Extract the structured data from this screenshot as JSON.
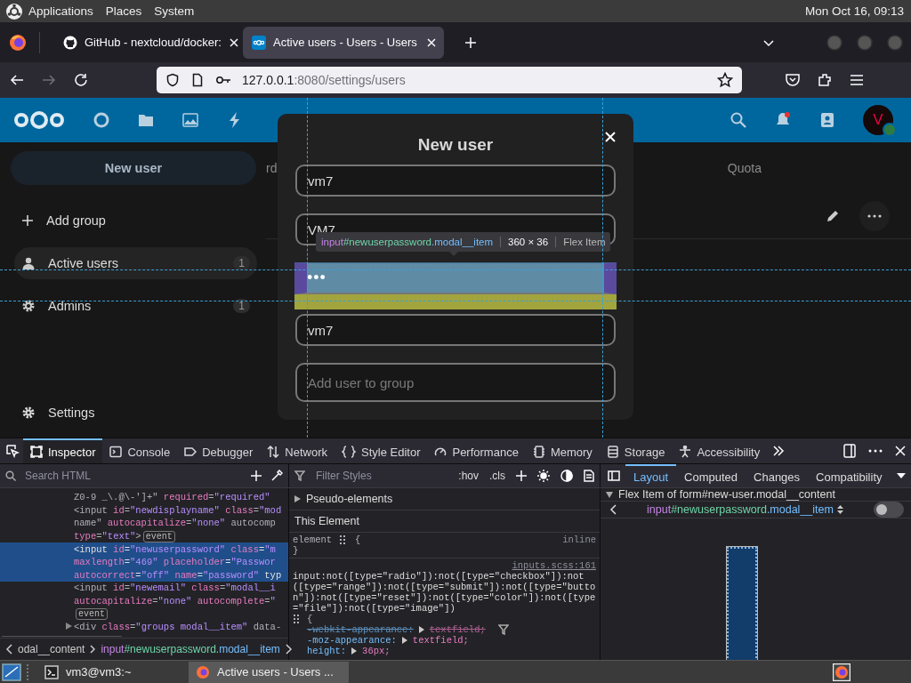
{
  "desktop_panel": {
    "menus": [
      "Applications",
      "Places",
      "System"
    ],
    "clock": "Mon Oct 16, 09:13"
  },
  "browser": {
    "tabs": [
      {
        "title": "GitHub - nextcloud/docker:",
        "kind": "github",
        "selected": false
      },
      {
        "title": "Active users - Users - Users",
        "kind": "nextcloud",
        "selected": true
      }
    ],
    "address": {
      "host": "127.0.0.1",
      "path": ":8080/settings/users"
    }
  },
  "nextcloud": {
    "avatar_letter": "V",
    "sidebar": {
      "new_user": "New user",
      "add_group": "Add group",
      "groups": [
        {
          "label": "Active users",
          "count": "1",
          "selected": true
        },
        {
          "label": "Admins",
          "count": "1",
          "selected": false
        }
      ],
      "settings": "Settings"
    },
    "columns": [
      "rd",
      "Quota"
    ],
    "modal": {
      "title": "New user",
      "fields": [
        {
          "value": "vm7",
          "inspected": false
        },
        {
          "value": "VM7",
          "inspected": false
        },
        {
          "value": "•••",
          "inspected": true
        },
        {
          "value": "vm7",
          "inspected": false
        },
        {
          "placeholder": "Add user to group",
          "inspected": false
        }
      ]
    },
    "inspector_tooltip": {
      "tag": "input",
      "id": "#newuserpassword",
      "class": ".modal__item",
      "size": "360 × 36",
      "kind": "Flex Item"
    }
  },
  "devtools": {
    "tabs": [
      {
        "label": "Inspector",
        "selected": true
      },
      {
        "label": "Console",
        "selected": false
      },
      {
        "label": "Debugger",
        "selected": false
      },
      {
        "label": "Network",
        "selected": false
      },
      {
        "label": "Style Editor",
        "selected": false
      },
      {
        "label": "Performance",
        "selected": false
      },
      {
        "label": "Memory",
        "selected": false
      },
      {
        "label": "Storage",
        "selected": false
      },
      {
        "label": "Accessibility",
        "selected": false
      }
    ],
    "search_placeholder": "Search HTML",
    "filter_placeholder": "Filter Styles",
    "style_toggles": [
      ":hov",
      ".cls"
    ],
    "sidebar_tabs": [
      {
        "label": "Layout",
        "selected": true
      },
      {
        "label": "Computed",
        "selected": false
      },
      {
        "label": "Changes",
        "selected": false
      },
      {
        "label": "Compatibility",
        "selected": false
      }
    ],
    "markup_lines": [
      {
        "text": "Z0-9 _\\.@\\-']+\" required=\"required\"",
        "selected": false,
        "expandable": false
      },
      {
        "text": "<input id=\"newdisplayname\" class=\"mod",
        "selected": false,
        "expandable": false
      },
      {
        "text": "name\" autocapitalize=\"none\" autocomp",
        "selected": false,
        "expandable": false
      },
      {
        "text": "type=\"text\">",
        "badge": "event",
        "selected": false,
        "expandable": false
      },
      {
        "text": "<input id=\"newuserpassword\" class=\"m",
        "selected": true,
        "expandable": false
      },
      {
        "text": "maxlength=\"469\" placeholder=\"Passwor",
        "selected": true,
        "expandable": false
      },
      {
        "text": "autocorrect=\"off\" name=\"password\" typ",
        "selected": true,
        "expandable": false
      },
      {
        "text": "<input id=\"newemail\" class=\"modal__i",
        "selected": false,
        "expandable": false
      },
      {
        "text": "autocapitalize=\"none\" autocomplete=\"",
        "selected": false,
        "expandable": false
      },
      {
        "badge": "event",
        "selected": false,
        "expandable": false
      },
      {
        "text": "<div class=\"groups modal__item\" data-",
        "selected": false,
        "expandable": true
      }
    ],
    "breadcrumbs": [
      "odal__content",
      {
        "tag": "input",
        "id": "#newuserpassword",
        "class": ".modal__item"
      }
    ],
    "rules": {
      "pseudo_elements": "Pseudo-elements",
      "this_element": "This Element",
      "element_rule": {
        "selector": "element",
        "open": "{",
        "close": "}",
        "origin": "inline"
      },
      "rule": {
        "source": "inputs.scss:161",
        "selector": "input:not([type=\"radio\"]):not([type=\"checkbox\"]):not([type=\"range\"]):not([type=\"submit\"]):not([type=\"button\"]):not([type=\"reset\"]):not([type=\"color\"]):not([type=\"file\"]):not([type=\"image\"])",
        "open": "{",
        "declarations": [
          {
            "property": "-webkit-appearance:",
            "value": "textfield;",
            "overridden": true
          },
          {
            "property": "-moz-appearance:",
            "value": "textfield;",
            "overridden": false
          },
          {
            "property": "height:",
            "value": "36px;",
            "overridden": false
          }
        ]
      }
    },
    "layout": {
      "heading": "Flex Item of form#new-user.modal__content",
      "item": {
        "tag": "input",
        "id": "#newuserpassword",
        "class": ".modal__item"
      },
      "toggle_on": false
    }
  },
  "taskbar": {
    "items": [
      {
        "label": "vm3@vm3:~",
        "kind": "terminal",
        "selected": false
      },
      {
        "label": "Active users - Users ...",
        "kind": "browser",
        "selected": true
      }
    ]
  }
}
